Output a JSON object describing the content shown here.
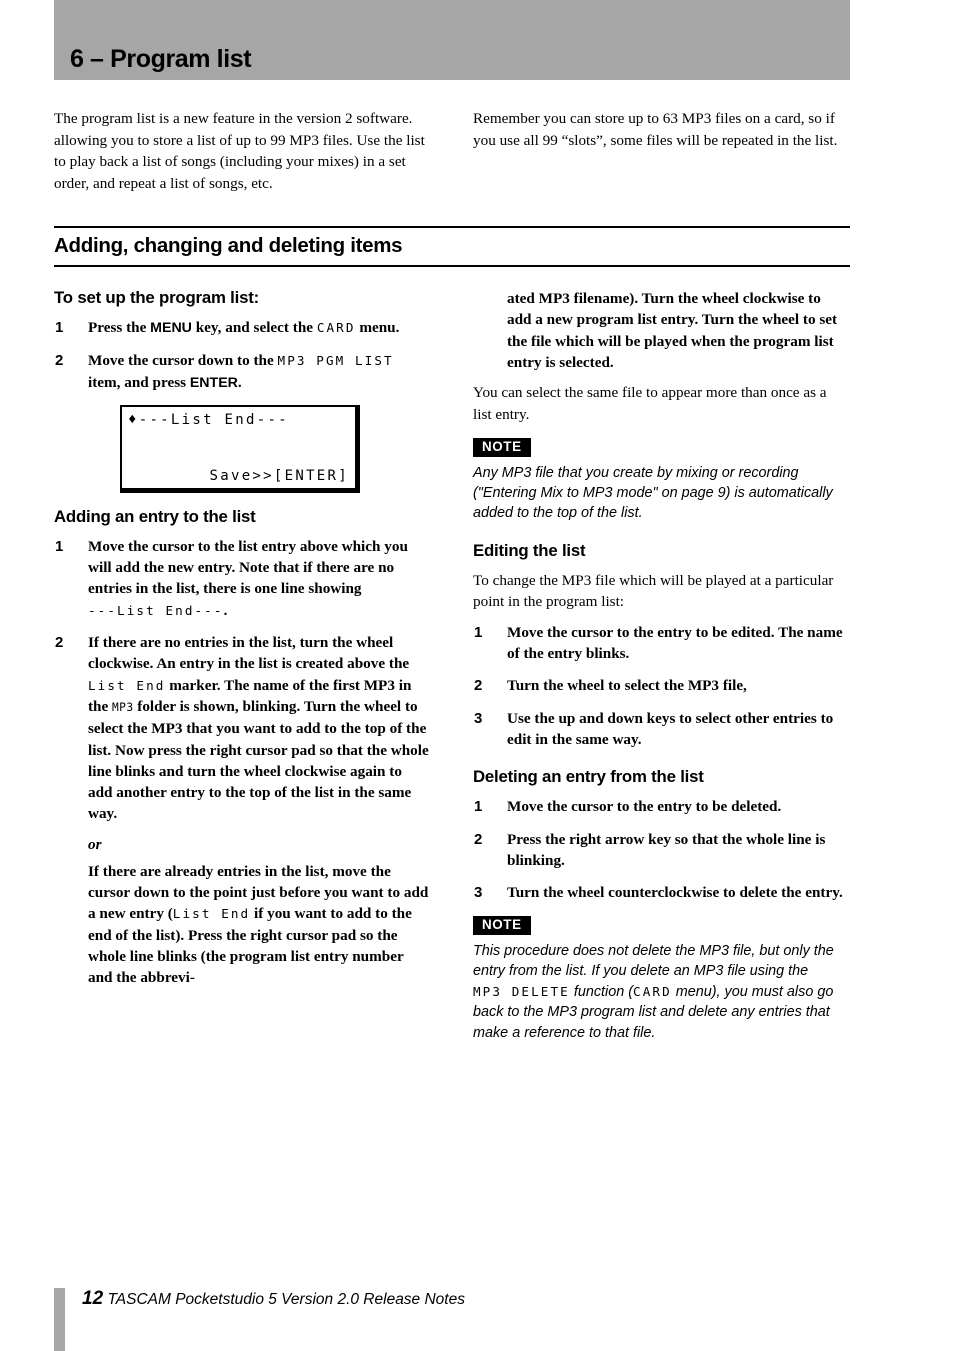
{
  "chapter": {
    "title": "6 – Program list",
    "bar_color": "#a6a6a6"
  },
  "intro": {
    "left": "The program list is a new feature in the version 2 software. allowing you to store a list of up to 99 MP3 files. Use the list to play back a list of songs (including your mixes) in a set order, and repeat a list of songs, etc.",
    "right": "Remember you can store up to 63 MP3 files on a card, so if you use all 99 “slots”, some files will be repeated in the list."
  },
  "section": {
    "heading": "Adding, changing and deleting items"
  },
  "left_column": {
    "setup": {
      "heading": "To set up the program list:",
      "step1": {
        "num": "1",
        "part_a": "Press the ",
        "key": "MENU",
        "part_b": " key, and select the ",
        "lcd": "CARD",
        "part_c": " menu."
      },
      "step2": {
        "num": "2",
        "part_a": "Move the cursor down to the ",
        "lcd1": "MP3 PGM LIST",
        "part_b": " item, and press ",
        "key": "ENTER",
        "part_c": "."
      }
    },
    "lcd_figure": {
      "line1": "♦---List End---",
      "line4": "Save>>[ENTER]"
    },
    "adding": {
      "heading": "Adding an entry to the list",
      "step1": {
        "num": "1",
        "part_a": "Move the cursor to the list entry above which you will add the new entry. Note that if there are no entries in the list, there is one line showing ",
        "lcd": "---List End---",
        "part_b": "."
      },
      "step2": {
        "num": "2",
        "part_a": "If there are no entries in the list, turn the wheel clockwise. An entry in the list is created above the ",
        "lcd1": "List End",
        "part_b": " marker. The name of the first MP3 in the ",
        "lcd2": "MP3",
        "part_c": " folder is shown, blinking. Turn the wheel to select the MP3 that you want to add to the top of the list. Now press the right cursor pad so that the whole line blinks and turn the wheel clockwise again to add another entry to the top of the list in the same way."
      },
      "or_label": "or",
      "alt_para": {
        "part_a": "If there are already entries in the list, move the cursor down to the point just before you want to add a new entry (",
        "lcd": "List End",
        "part_b": " if you want to add to the end of the list). Press the right cursor pad so the whole line blinks (the program list entry number and the abbrevi-"
      }
    }
  },
  "right_column": {
    "continuation": "ated MP3 filename). Turn the wheel clockwise to add a new program list entry. Turn the wheel to set the file which will be played when the program list entry is selected.",
    "same_file_para": "You can select the same file to appear more than once as a list entry.",
    "note1": {
      "badge": "NOTE",
      "body": "Any MP3 file that you create by mixing or recording (\"Entering Mix to MP3 mode\" on page 9) is automatically added to the top of the list."
    },
    "editing": {
      "heading": "Editing the list",
      "intro": "To change the MP3 file which will be played at a particular point in the program list:",
      "steps": [
        {
          "num": "1",
          "text": "Move the cursor to the entry to be edited. The name of the entry blinks."
        },
        {
          "num": "2",
          "text": "Turn the wheel to select the MP3 file,"
        },
        {
          "num": "3",
          "text": "Use the up and down keys to select other entries to edit in the same way."
        }
      ]
    },
    "deleting": {
      "heading": "Deleting an entry from the list",
      "steps": [
        {
          "num": "1",
          "text": "Move the cursor to the entry to be deleted."
        },
        {
          "num": "2",
          "text": "Press the right arrow key so that the whole line is blinking."
        },
        {
          "num": "3",
          "text": "Turn the wheel counterclockwise to delete the entry."
        }
      ]
    },
    "note2": {
      "badge": "NOTE",
      "part_a": "This procedure does not delete the MP3 file, but only the entry from the list. If you delete an MP3 file using the ",
      "lcd1": "MP3 DELETE",
      "part_b": " function (",
      "lcd2": "CARD",
      "part_c": " menu), you must also go back to the MP3 program list and delete any entries that make a reference to that file."
    }
  },
  "footer": {
    "page_number": "12",
    "text": " TASCAM Pocketstudio 5 Version 2.0 Release Notes",
    "bar_color": "#a6a6a6"
  }
}
